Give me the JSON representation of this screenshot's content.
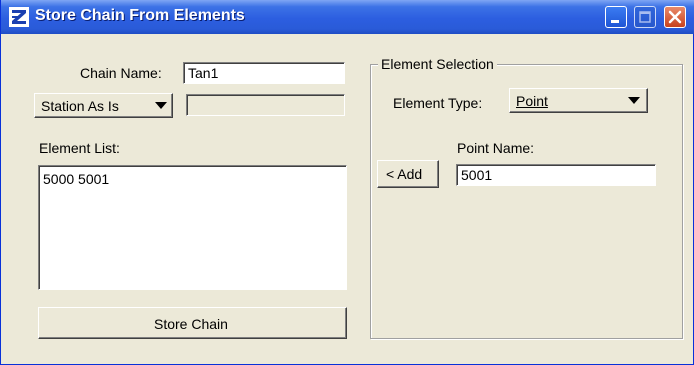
{
  "window": {
    "title": "Store Chain From Elements",
    "icon": "app-logo-icon",
    "controls": [
      "minimize-icon",
      "maximize-icon",
      "close-icon"
    ],
    "colors": {
      "titlebar": "#2a5bd8",
      "body": "#ece9d8",
      "close": "#c8421e"
    }
  },
  "chain_name": {
    "label": "Chain Name:",
    "value": "Tan1"
  },
  "station": {
    "selected": "Station As Is",
    "value": ""
  },
  "element_list": {
    "label": "Element List:",
    "items": [
      "5000 5001"
    ]
  },
  "store_button": {
    "label": "Store Chain"
  },
  "element_selection": {
    "title": "Element Selection",
    "element_type": {
      "label": "Element Type:",
      "selected": "Point"
    },
    "point_name": {
      "label": "Point Name:",
      "value": "5001"
    },
    "add_button": {
      "label": "< Add"
    }
  }
}
